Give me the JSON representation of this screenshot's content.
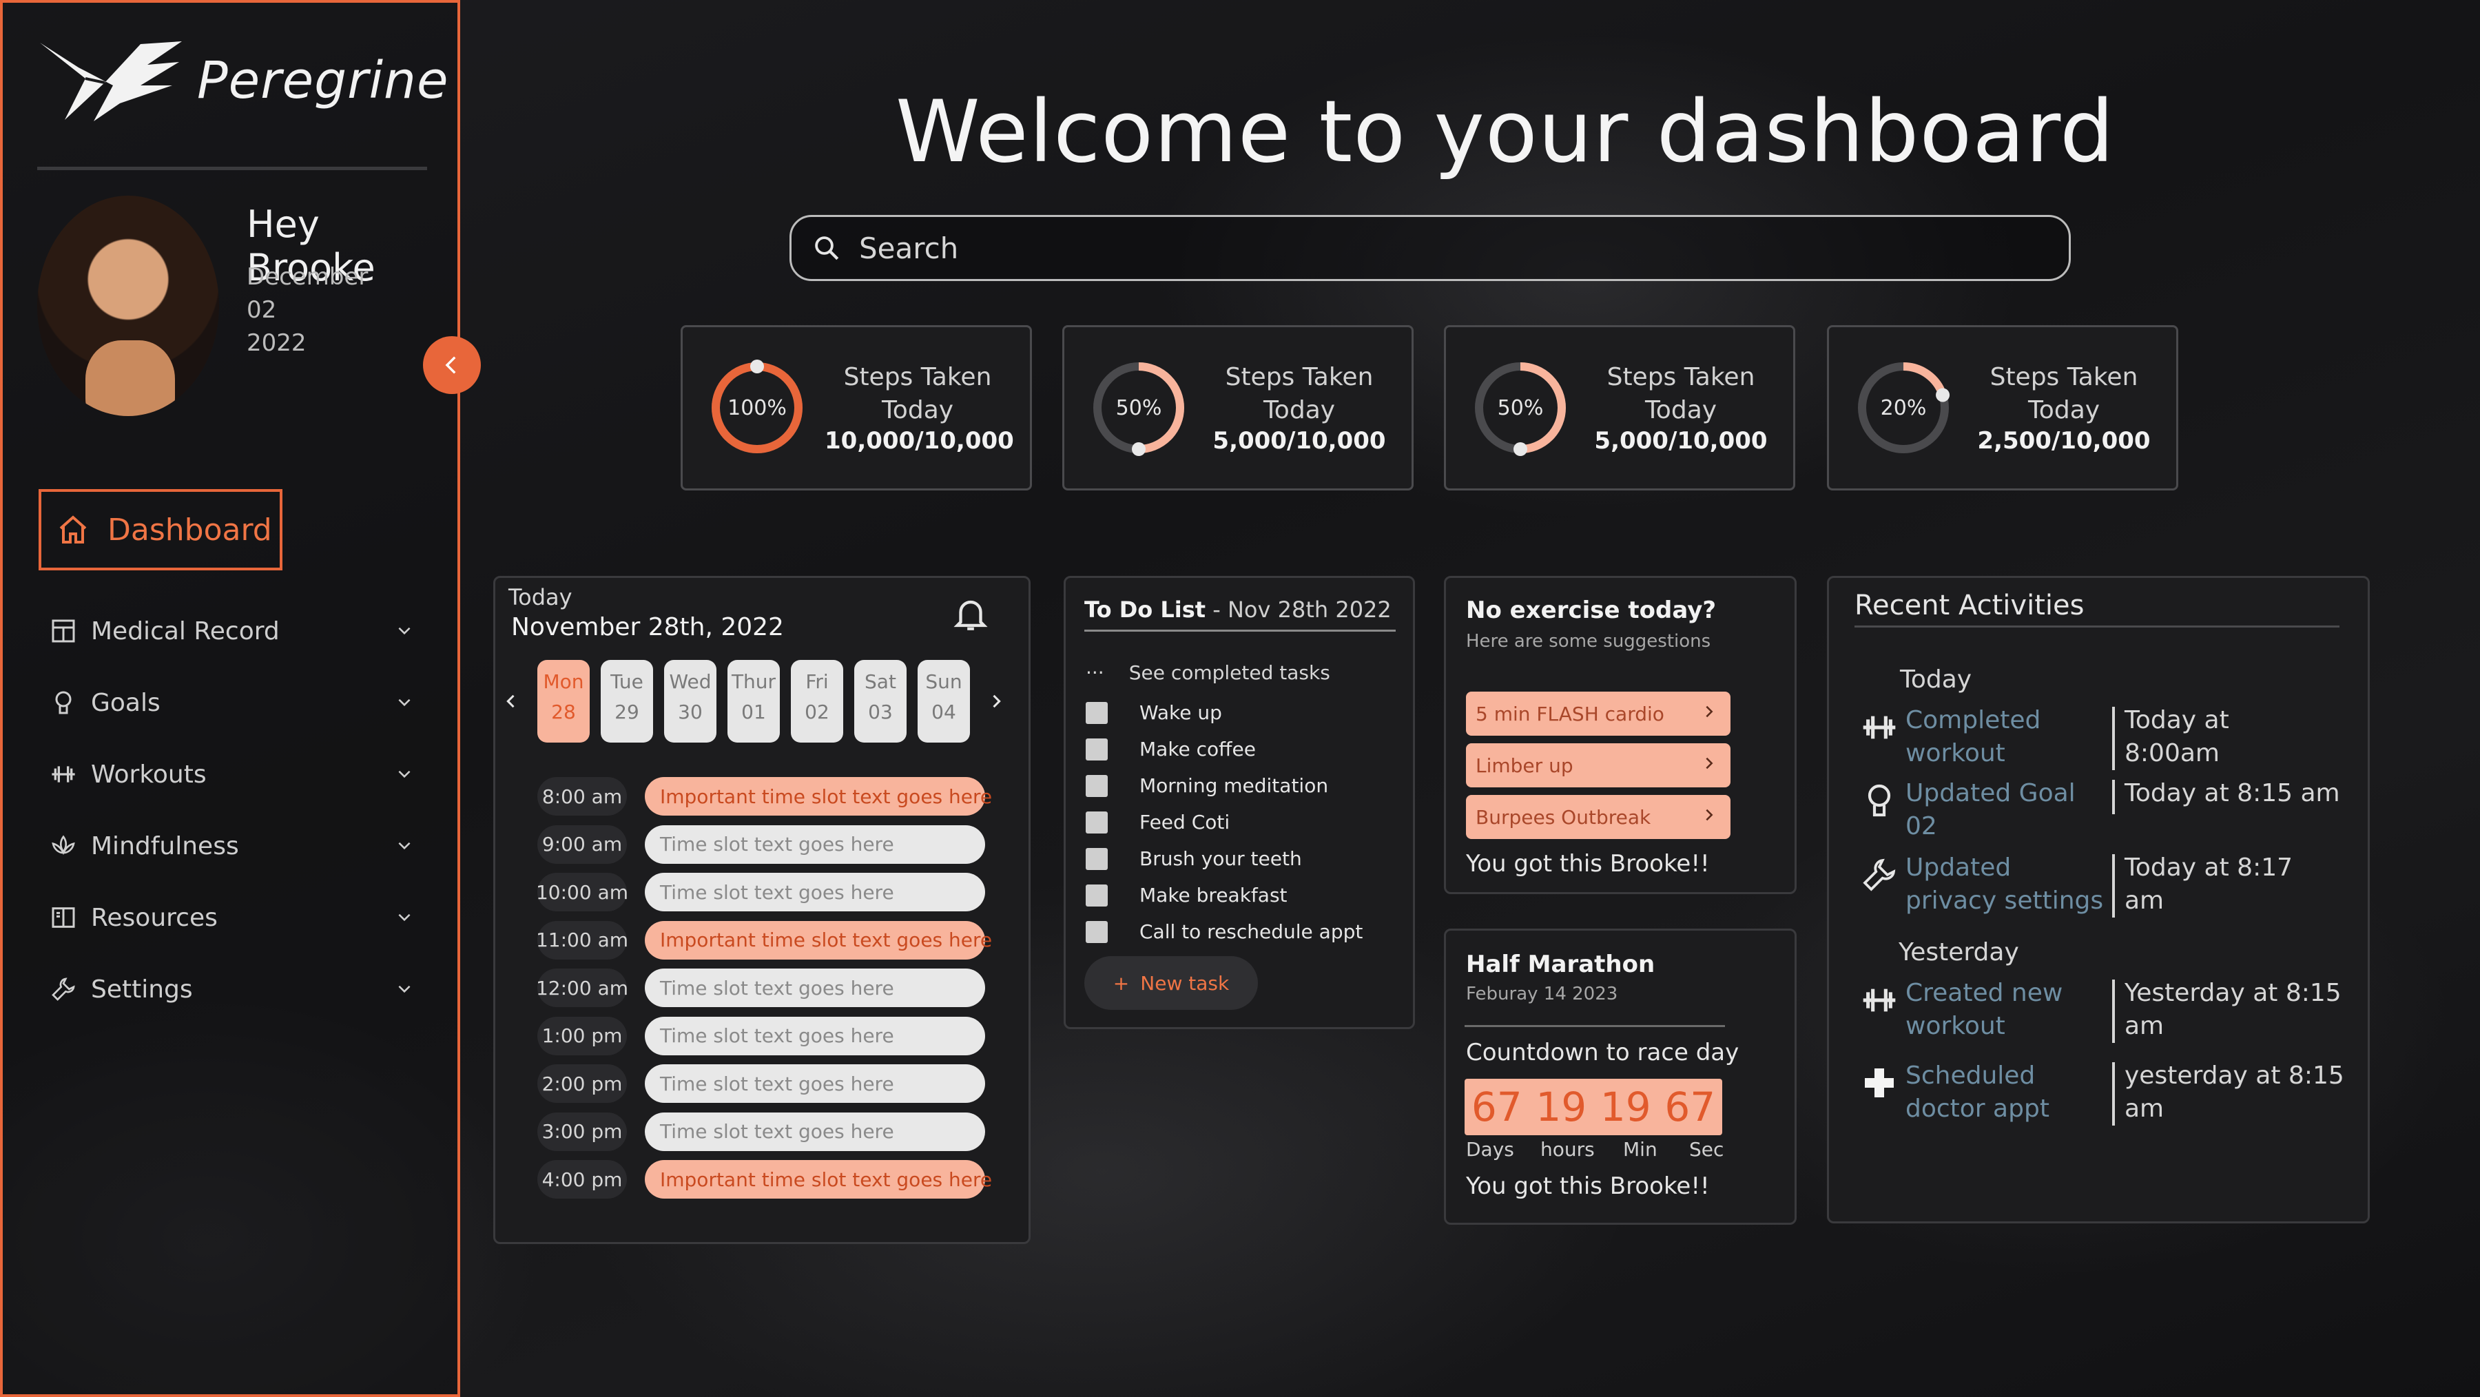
{
  "brand": {
    "name": "Peregrine"
  },
  "user": {
    "greeting": "Hey Brooke",
    "month": "December",
    "day": "02",
    "year": "2022"
  },
  "sidebar": {
    "dashboard_label": "Dashboard",
    "items": [
      {
        "label": "Medical Record",
        "icon": "medical-record-icon"
      },
      {
        "label": "Goals",
        "icon": "goals-icon"
      },
      {
        "label": "Workouts",
        "icon": "dumbbell-icon"
      },
      {
        "label": "Mindfulness",
        "icon": "lotus-icon"
      },
      {
        "label": "Resources",
        "icon": "book-icon"
      },
      {
        "label": "Settings",
        "icon": "wrench-icon"
      }
    ]
  },
  "header": {
    "title": "Welcome to your dashboard"
  },
  "search": {
    "placeholder": "Search"
  },
  "stats": [
    {
      "label": "Steps Taken Today",
      "pct_text": "100%",
      "progress": 1.0,
      "value": "10,000/10,000"
    },
    {
      "label": "Steps Taken Today",
      "pct_text": "50%",
      "progress": 0.5,
      "value": "5,000/10,000"
    },
    {
      "label": "Steps Taken Today",
      "pct_text": "50%",
      "progress": 0.5,
      "value": "5,000/10,000"
    },
    {
      "label": "Steps Taken Today",
      "pct_text": "20%",
      "progress": 0.2,
      "value": "2,500/10,000"
    }
  ],
  "calendar": {
    "today_label": "Today",
    "date": "November 28th, 2022",
    "days": [
      {
        "name": "Mon",
        "num": "28",
        "active": true
      },
      {
        "name": "Tue",
        "num": "29",
        "active": false
      },
      {
        "name": "Wed",
        "num": "30",
        "active": false
      },
      {
        "name": "Thur",
        "num": "01",
        "active": false
      },
      {
        "name": "Fri",
        "num": "02",
        "active": false
      },
      {
        "name": "Sat",
        "num": "03",
        "active": false
      },
      {
        "name": "Sun",
        "num": "04",
        "active": false
      }
    ],
    "slots": [
      {
        "time": "8:00 am",
        "text": "Important time slot text goes here",
        "important": true
      },
      {
        "time": "9:00 am",
        "text": "Time slot text goes here",
        "important": false
      },
      {
        "time": "10:00 am",
        "text": "Time slot text goes here",
        "important": false
      },
      {
        "time": "11:00 am",
        "text": "Important time slot text goes here",
        "important": true
      },
      {
        "time": "12:00 am",
        "text": "Time slot text goes here",
        "important": false
      },
      {
        "time": "1:00 pm",
        "text": "Time slot text goes here",
        "important": false
      },
      {
        "time": "2:00 pm",
        "text": "Time slot text goes here",
        "important": false
      },
      {
        "time": "3:00 pm",
        "text": "Time slot text goes here",
        "important": false
      },
      {
        "time": "4:00 pm",
        "text": "Important time slot text goes here",
        "important": true
      }
    ]
  },
  "todo": {
    "title": "To Do List",
    "date": " - Nov 28th 2022",
    "see_completed": "See completed tasks",
    "items": [
      "Wake up",
      "Make coffee",
      "Morning meditation",
      "Feed Coti",
      "Brush your teeth",
      "Make breakfast",
      "Call to reschedule appt"
    ],
    "new_task": "New task"
  },
  "suggestions": {
    "title": "No exercise today?",
    "subtitle": "Here are some suggestions",
    "items": [
      "5 min FLASH cardio",
      "Limber up",
      "Burpees Outbreak"
    ],
    "footer": "You got this Brooke!!"
  },
  "race": {
    "title": "Half Marathon",
    "date": "Feburay 14 2023",
    "countdown_label": "Countdown to race day",
    "values": [
      "67",
      "19",
      "19",
      "67"
    ],
    "units": [
      "Days",
      "hours",
      "Min",
      "Sec"
    ],
    "footer": "You got this Brooke!!"
  },
  "activities": {
    "title": "Recent Activities",
    "today_label": "Today",
    "yesterday_label": "Yesterday",
    "items": [
      {
        "line1": "Completed",
        "line2": "workout",
        "time1": "Today at",
        "time2": "8:00am",
        "icon": "dumbbell-icon"
      },
      {
        "line1": "Updated Goal",
        "line2": "02",
        "time1": "Today at 8:15 am",
        "time2": "",
        "icon": "goals-icon"
      },
      {
        "line1": "Updated",
        "line2": "privacy settings",
        "time1": "Today at 8:17",
        "time2": "am",
        "icon": "wrench-icon"
      },
      {
        "line1": "Created new",
        "line2": "workout",
        "time1": "Yesterday at 8:15",
        "time2": "am",
        "icon": "dumbbell-icon"
      },
      {
        "line1": "Scheduled",
        "line2": "doctor appt",
        "time1": "yesterday at 8:15",
        "time2": "am",
        "icon": "medical-cross-icon"
      }
    ]
  },
  "colors": {
    "accent": "#e8663a",
    "accent_light": "#f8b49c",
    "link": "#6e8ea3"
  }
}
